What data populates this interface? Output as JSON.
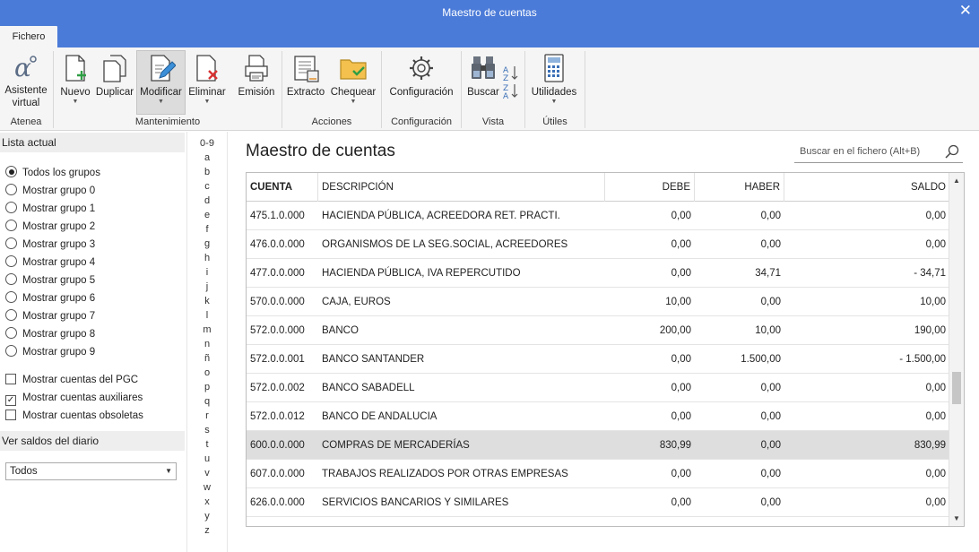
{
  "window": {
    "title": "Maestro de cuentas",
    "close_glyph": "✕"
  },
  "ribbon": {
    "tab": "Fichero",
    "buttons": {
      "asistente": "Asistente\nvirtual",
      "nuevo": "Nuevo",
      "duplicar": "Duplicar",
      "modificar": "Modificar",
      "eliminar": "Eliminar",
      "emision": "Emisión",
      "extracto": "Extracto",
      "chequear": "Chequear",
      "configuracion": "Configuración",
      "buscar": "Buscar",
      "utilidades": "Utilidades"
    },
    "groups": {
      "atenea": "Atenea",
      "mantenimiento": "Mantenimiento",
      "acciones": "Acciones",
      "configuracion": "Configuración",
      "vista": "Vista",
      "utiles": "Útiles"
    }
  },
  "left_panel": {
    "lista_actual": "Lista actual",
    "radios": [
      "Todos los grupos",
      "Mostrar grupo 0",
      "Mostrar grupo 1",
      "Mostrar grupo 2",
      "Mostrar grupo 3",
      "Mostrar grupo 4",
      "Mostrar grupo 5",
      "Mostrar grupo 6",
      "Mostrar grupo 7",
      "Mostrar grupo 8",
      "Mostrar grupo 9"
    ],
    "selected_radio": "Todos los grupos",
    "checks": [
      {
        "label": "Mostrar cuentas del PGC",
        "checked": false
      },
      {
        "label": "Mostrar cuentas auxiliares",
        "checked": true
      },
      {
        "label": "Mostrar cuentas obsoletas",
        "checked": false
      }
    ],
    "ver_saldos": "Ver saldos del diario",
    "select_value": "Todos"
  },
  "alpha_index": [
    "0-9",
    "a",
    "b",
    "c",
    "d",
    "e",
    "f",
    "g",
    "h",
    "i",
    "j",
    "k",
    "l",
    "m",
    "n",
    "ñ",
    "o",
    "p",
    "q",
    "r",
    "s",
    "t",
    "u",
    "v",
    "w",
    "x",
    "y",
    "z"
  ],
  "main": {
    "title": "Maestro de cuentas",
    "search_placeholder": "Buscar en el fichero (Alt+B)",
    "columns": {
      "cuenta": "CUENTA",
      "descripcion": "DESCRIPCIÓN",
      "debe": "DEBE",
      "haber": "HABER",
      "saldo": "SALDO"
    },
    "rows": [
      {
        "cuenta": "475.1.0.000",
        "descripcion": "HACIENDA PÚBLICA, ACREEDORA RET. PRACTI.",
        "debe": "0,00",
        "haber": "0,00",
        "saldo": "0,00"
      },
      {
        "cuenta": "476.0.0.000",
        "descripcion": "ORGANISMOS DE LA SEG.SOCIAL, ACREEDORES",
        "debe": "0,00",
        "haber": "0,00",
        "saldo": "0,00"
      },
      {
        "cuenta": "477.0.0.000",
        "descripcion": "HACIENDA PÚBLICA, IVA REPERCUTIDO",
        "debe": "0,00",
        "haber": "34,71",
        "saldo": "- 34,71"
      },
      {
        "cuenta": "570.0.0.000",
        "descripcion": "CAJA, EUROS",
        "debe": "10,00",
        "haber": "0,00",
        "saldo": "10,00"
      },
      {
        "cuenta": "572.0.0.000",
        "descripcion": "BANCO",
        "debe": "200,00",
        "haber": "10,00",
        "saldo": "190,00"
      },
      {
        "cuenta": "572.0.0.001",
        "descripcion": "BANCO SANTANDER",
        "debe": "0,00",
        "haber": "1.500,00",
        "saldo": "- 1.500,00"
      },
      {
        "cuenta": "572.0.0.002",
        "descripcion": "BANCO SABADELL",
        "debe": "0,00",
        "haber": "0,00",
        "saldo": "0,00"
      },
      {
        "cuenta": "572.0.0.012",
        "descripcion": "BANCO DE ANDALUCIA",
        "debe": "0,00",
        "haber": "0,00",
        "saldo": "0,00"
      },
      {
        "cuenta": "600.0.0.000",
        "descripcion": "COMPRAS DE MERCADERÍAS",
        "debe": "830,99",
        "haber": "0,00",
        "saldo": "830,99"
      },
      {
        "cuenta": "607.0.0.000",
        "descripcion": "TRABAJOS REALIZADOS POR OTRAS EMPRESAS",
        "debe": "0,00",
        "haber": "0,00",
        "saldo": "0,00"
      },
      {
        "cuenta": "626.0.0.000",
        "descripcion": "SERVICIOS BANCARIOS Y SIMILARES",
        "debe": "0,00",
        "haber": "0,00",
        "saldo": "0,00"
      }
    ],
    "selected_row": "600.0.0.000"
  },
  "colors": {
    "titlebar": "#4b7bd8",
    "ribbon": "#f5f5f5",
    "selected_row": "#dedede"
  }
}
